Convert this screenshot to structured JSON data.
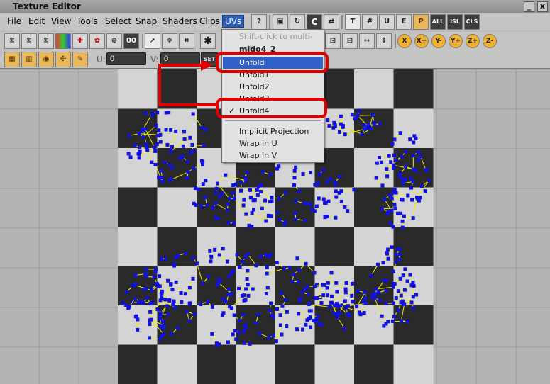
{
  "window": {
    "title": "Texture Editor",
    "minimize_label": "_",
    "close_label": "x"
  },
  "menus": [
    {
      "label": "File"
    },
    {
      "label": "Edit"
    },
    {
      "label": "View"
    },
    {
      "label": "Tools"
    },
    {
      "label": "Select"
    },
    {
      "label": "Snap"
    },
    {
      "label": "Shaders"
    },
    {
      "label": "Clips"
    },
    {
      "label": "UVs"
    }
  ],
  "toolbar": {
    "text_tools": [
      "T",
      "ALL",
      "ISL",
      "CLS"
    ],
    "axis_buttons": [
      "X",
      "X+",
      "Y-",
      "Y+",
      "Z+",
      "Z-"
    ],
    "u_label": "U:",
    "u_value": "0",
    "v_label": "V:",
    "v_value": "0",
    "set_label": "SET"
  },
  "uvs_menu": {
    "items": [
      {
        "label": "Shift-click to multi-edit",
        "state": "disabled"
      },
      {
        "label": "mido4_2",
        "state": "header"
      },
      {
        "label": "Unfold",
        "state": "selected"
      },
      {
        "label": "Unfold1",
        "state": "normal"
      },
      {
        "label": "Unfold2",
        "state": "normal"
      },
      {
        "label": "Unfold3",
        "state": "normal"
      },
      {
        "label": "Unfold4",
        "state": "checked"
      },
      {
        "label": "Implicit Projection",
        "state": "normal"
      },
      {
        "label": "Wrap in U",
        "state": "normal"
      },
      {
        "label": "Wrap in V",
        "state": "normal"
      }
    ],
    "check_glyph": "✓"
  },
  "colors": {
    "checker_light": "#d4d4d4",
    "checker_dark": "#2a2a2a",
    "uv_points": "#1010e0",
    "uv_edges": "#f0f000",
    "annotation": "#e00000",
    "menu_highlight": "#3060c8"
  }
}
